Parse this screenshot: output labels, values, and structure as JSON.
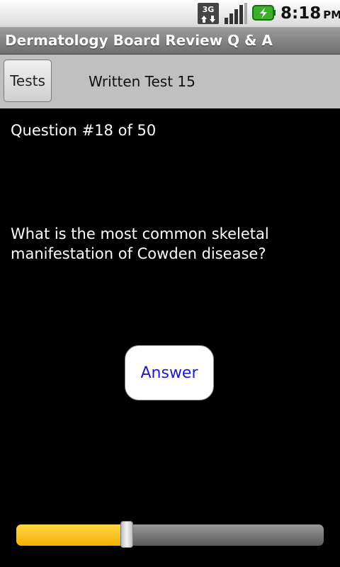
{
  "status_bar": {
    "network_label": "3G",
    "time": "8:18",
    "ampm": "PM",
    "icons": [
      "3g-data-icon",
      "signal-strength-icon",
      "battery-charging-icon"
    ]
  },
  "app": {
    "title": "Dermatology Board Review Q & A"
  },
  "toolbar": {
    "tests_label": "Tests",
    "test_name": "Written Test 15"
  },
  "question": {
    "number_label": "Question #18 of 50",
    "text": "What is the most common skeletal manifestation of Cowden disease?"
  },
  "answer_button": {
    "label": "Answer"
  },
  "progress_slider": {
    "current": 18,
    "total": 50
  },
  "colors": {
    "slider_fill": "#f5b000",
    "answer_text": "#1a1acc",
    "battery": "#3fae2a"
  }
}
